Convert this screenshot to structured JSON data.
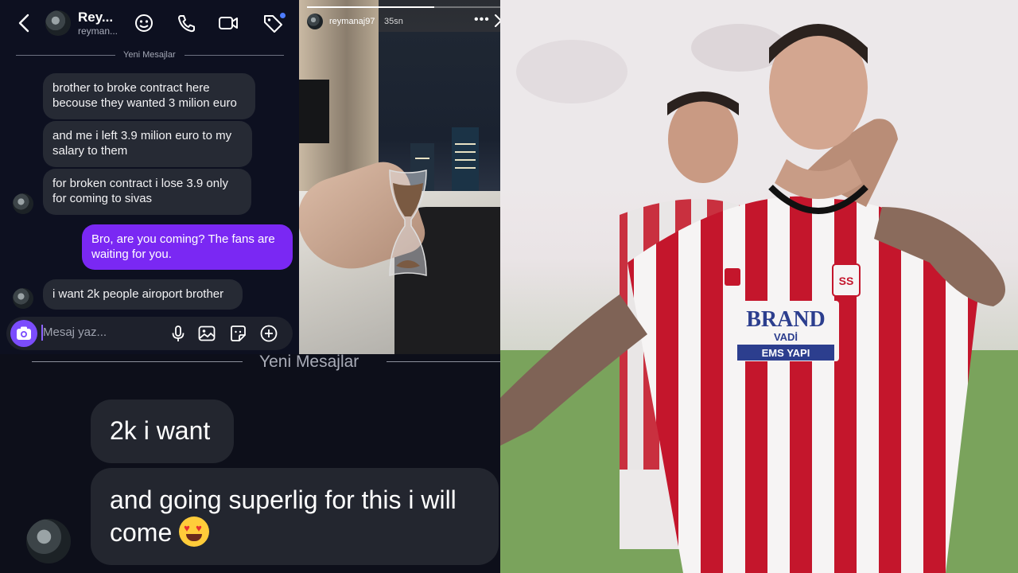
{
  "chat": {
    "name": "Rey...",
    "username": "reyman...",
    "separator_label": "Yeni Mesajlar",
    "messages": [
      {
        "from": "them",
        "text": "brother to broke contract here\nbecouse they wanted 3 milion euro"
      },
      {
        "from": "them",
        "text": "and me i left 3.9 milion euro to my\nsalary to them"
      },
      {
        "from": "them",
        "text": "for broken contract i lose 3.9 only\nfor coming to sivas"
      },
      {
        "from": "me",
        "text": "Bro, are you coming? The fans are\nwaiting for you."
      },
      {
        "from": "them",
        "text": "i want 2k people airoport brother"
      }
    ],
    "composer_placeholder": "Mesaj yaz...",
    "header_icons": [
      "back-arrow-icon",
      "sticker-face-icon",
      "phone-icon",
      "video-icon",
      "tag-icon"
    ],
    "composer_icons": [
      "camera-icon",
      "microphone-icon",
      "image-icon",
      "sticker-icon",
      "plus-circle-icon"
    ],
    "accent_color": "#7a28f3"
  },
  "story": {
    "username": "reymanaj97",
    "time": "35sn",
    "more_icon": "more-dots-icon",
    "close_icon": "close-icon",
    "progress": 0.64
  },
  "zoom": {
    "separator_label": "Yeni Mesajlar",
    "messages": [
      {
        "text": "2k i want"
      },
      {
        "text": "and going superlig for this i will\ncome",
        "emoji": "heart-eyes-emoji"
      }
    ]
  },
  "photo": {
    "sponsor_line1": "BRAND",
    "sponsor_line2": "VADİ",
    "sponsor_line3": "EMS YAPI",
    "club_badge": "SS"
  }
}
